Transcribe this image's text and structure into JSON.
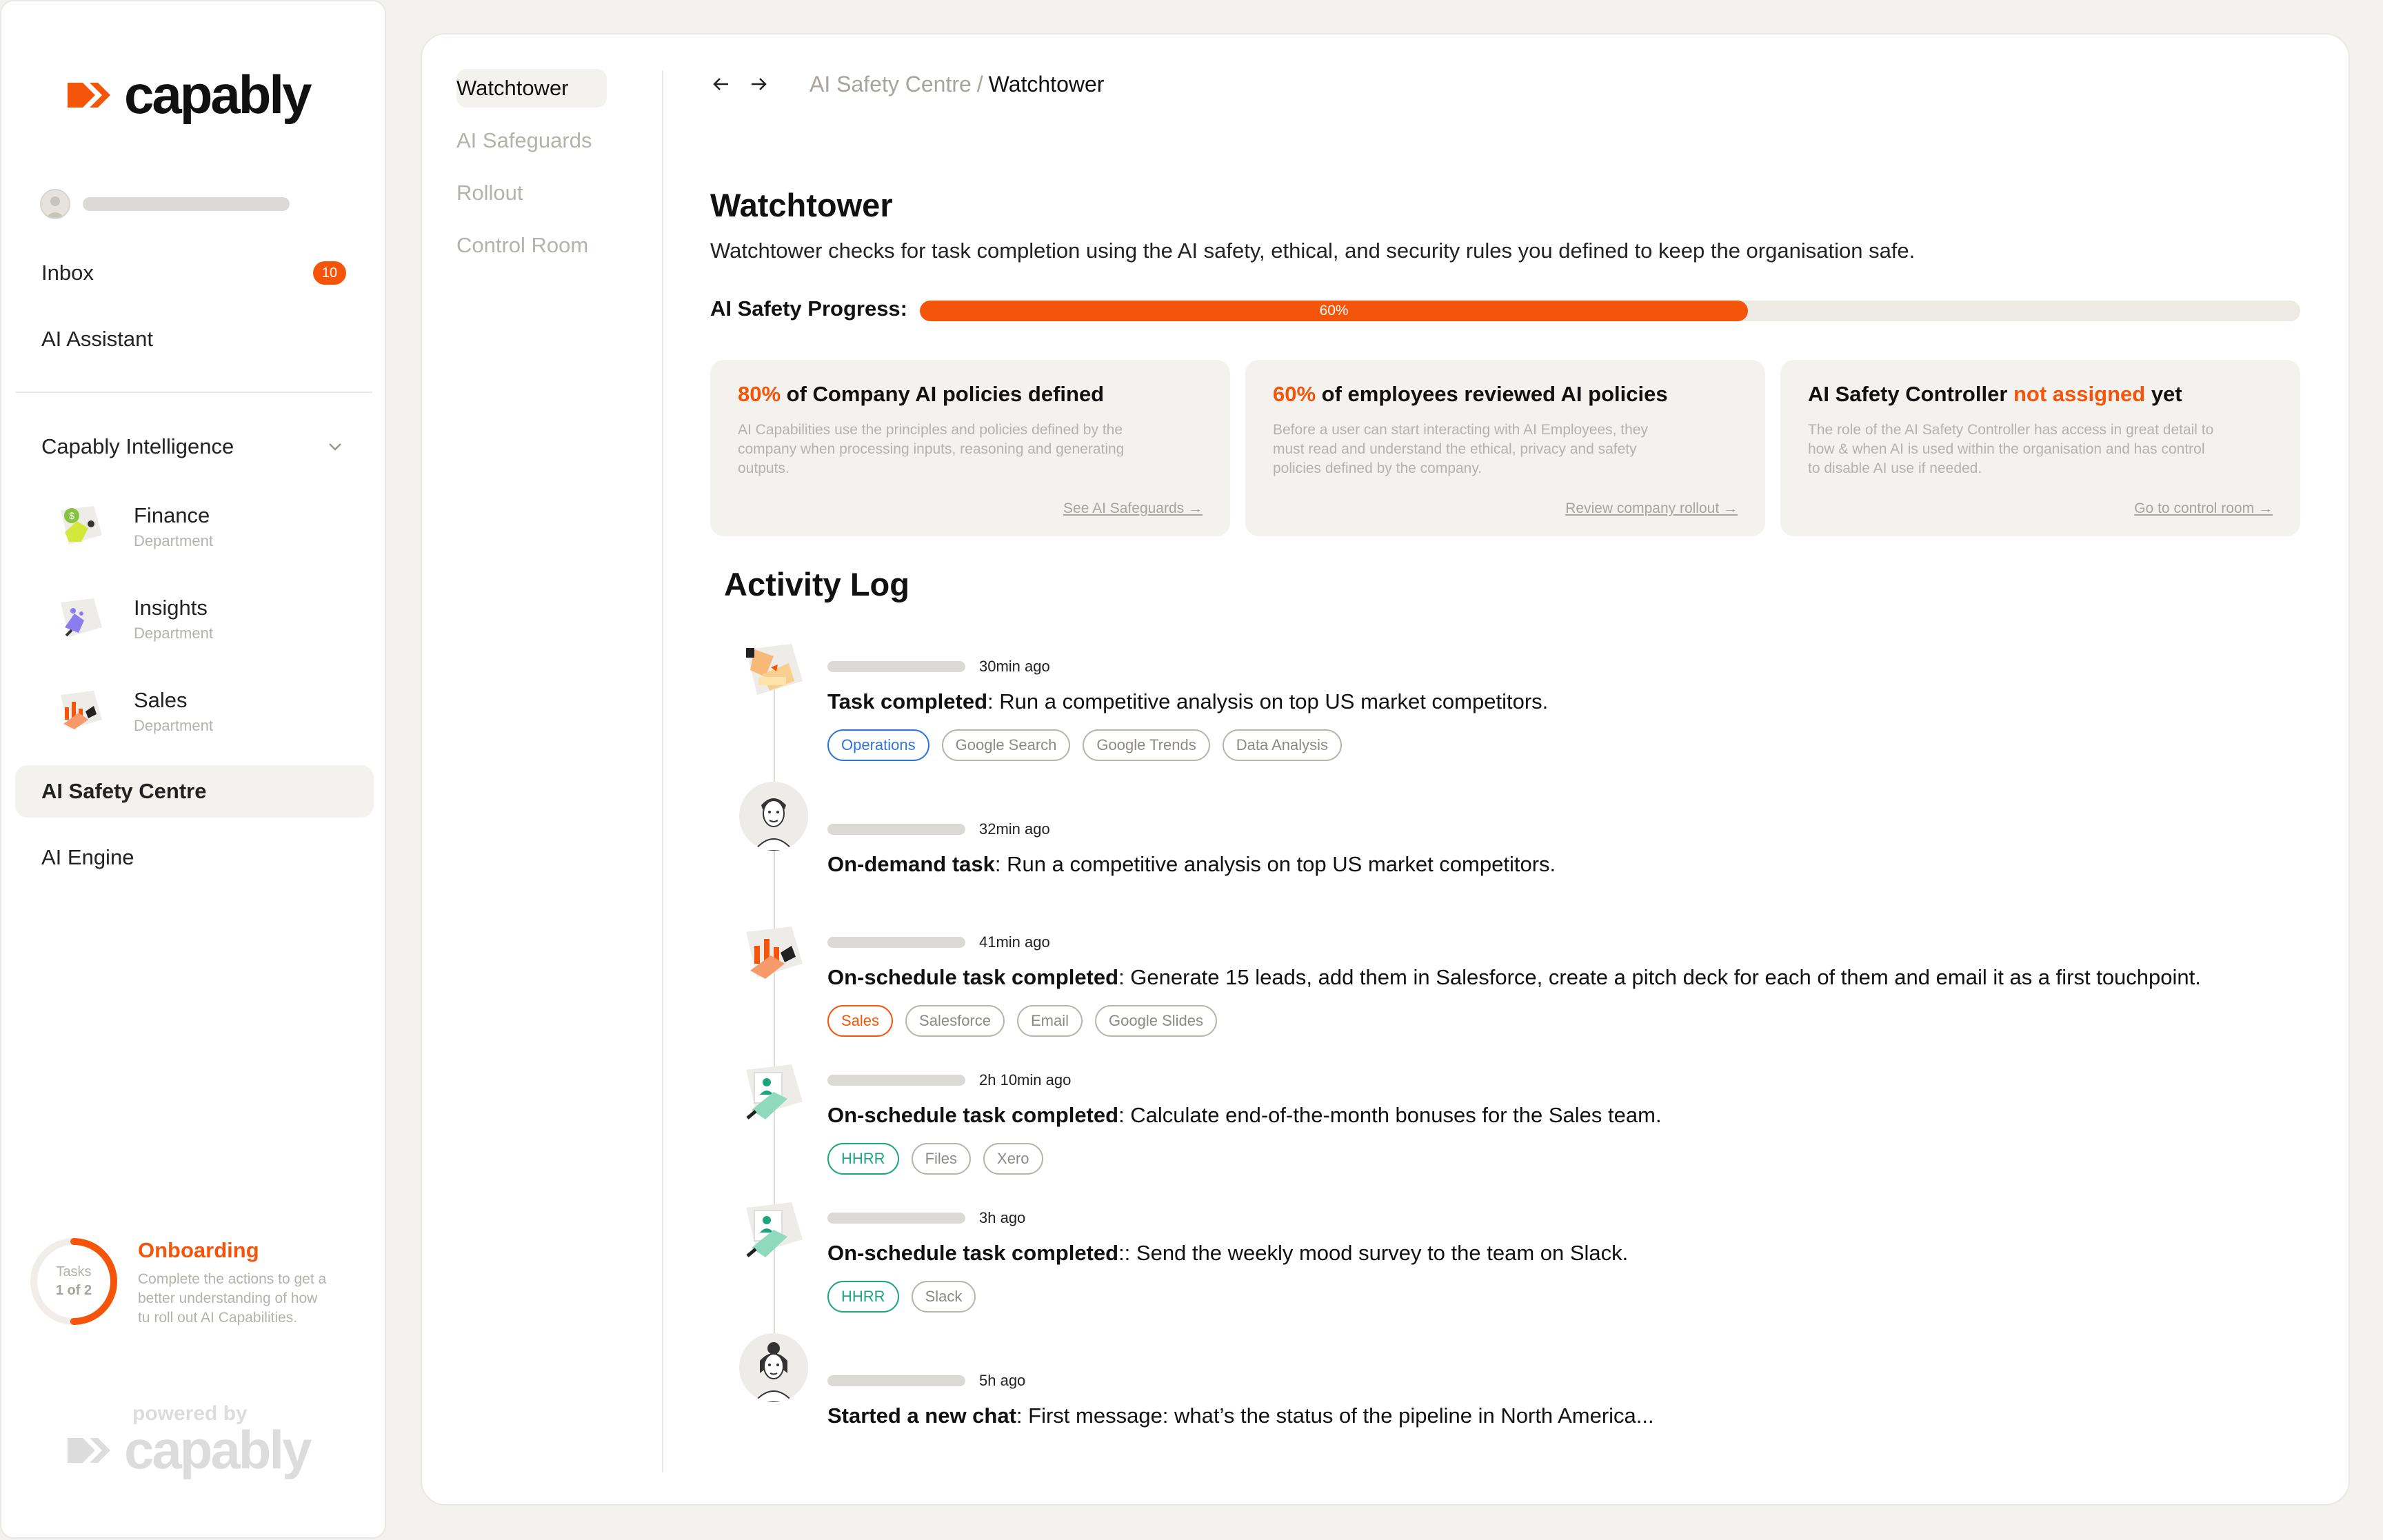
{
  "sidebar": {
    "logo_text": "capably",
    "inbox": {
      "label": "Inbox",
      "badge": "10"
    },
    "ai_assistant": "AI Assistant",
    "section": {
      "label": "Capably Intelligence"
    },
    "departments": [
      {
        "name": "Finance",
        "sub": "Department"
      },
      {
        "name": "Insights",
        "sub": "Department"
      },
      {
        "name": "Sales",
        "sub": "Department"
      }
    ],
    "ai_safety_centre": "AI Safety Centre",
    "ai_engine": "AI Engine",
    "onboarding": {
      "tasks_label": "Tasks",
      "count": "1 of 2",
      "progress": 0.5,
      "title": "Onboarding",
      "desc_1": "Complete the actions to get a",
      "desc_2": "better understanding of how",
      "desc_3": "tu roll out AI Capabilities."
    },
    "powered_label": "powered by",
    "powered_logo": "capably"
  },
  "subnav": {
    "items": [
      {
        "label": "Watchtower",
        "active": true
      },
      {
        "label": "AI Safeguards"
      },
      {
        "label": "Rollout"
      },
      {
        "label": "Control Room"
      }
    ]
  },
  "breadcrumb": {
    "parent": "AI Safety Centre",
    "separator": "/",
    "current": "Watchtower"
  },
  "page": {
    "title": "Watchtower",
    "description": "Watchtower checks for task completion using the AI safety, ethical, and security rules you defined to keep the organisation safe."
  },
  "progress": {
    "label": "AI Safety Progress:",
    "value": 60,
    "text": "60%"
  },
  "cards": [
    {
      "highlight": "80%",
      "title_rest": " of Company AI policies defined",
      "desc_1": "AI Capabilities use the principles and policies defined by the",
      "desc_2": "company when processing inputs, reasoning and generating",
      "desc_3": "outputs.",
      "link": "See AI Safeguards →"
    },
    {
      "highlight": "60%",
      "title_rest": " of employees reviewed AI policies",
      "desc_1": "Before a user can start interacting with AI Employees, they",
      "desc_2": "must read and understand the ethical, privacy and safety",
      "desc_3": "policies  defined by the company.",
      "link": "Review company rollout →"
    },
    {
      "title_pre": "AI Safety Controller ",
      "highlight": "not assigned",
      "title_post": " yet",
      "desc_1": "The role of the AI Safety Controller has access in great detail to",
      "desc_2": "how & when AI is used within the organisation and has control",
      "desc_3": "to disable AI use if needed.",
      "link": "Go to control room →"
    }
  ],
  "activity": {
    "title": "Activity Log",
    "entries": [
      {
        "time": "30min ago",
        "bold": "Task completed",
        "text": ": Run a competitive analysis on top US market competitors.",
        "tags": [
          "Operations",
          "Google Search",
          "Google Trends",
          "Data Analysis"
        ]
      },
      {
        "time": "32min ago",
        "bold": "On-demand task",
        "text": ": Run a competitive analysis on top US market competitors.",
        "tags": []
      },
      {
        "time": "41min ago",
        "bold": "On-schedule task completed",
        "text": ": Generate 15 leads, add them in Salesforce, create a pitch deck for each of them and email it as a first touchpoint.",
        "tags": [
          "Sales",
          "Salesforce",
          "Email",
          "Google Slides"
        ]
      },
      {
        "time": "2h 10min ago",
        "bold": "On-schedule task completed",
        "text": ": Calculate end-of-the-month bonuses for the Sales team.",
        "tags": [
          "HHRR",
          "Files",
          "Xero"
        ]
      },
      {
        "time": "3h ago",
        "bold": "On-schedule task completed",
        "text": ":: Send the weekly mood survey to the team on Slack.",
        "tags": [
          "HHRR",
          "Slack"
        ]
      },
      {
        "time": "5h ago",
        "bold": "Started a new chat",
        "text": ": First message: what’s the status of the pipeline in North America...",
        "tags": []
      }
    ]
  },
  "colors": {
    "accent": "#f5550a",
    "blue": "#2f74d8",
    "green": "#1ea57e"
  }
}
